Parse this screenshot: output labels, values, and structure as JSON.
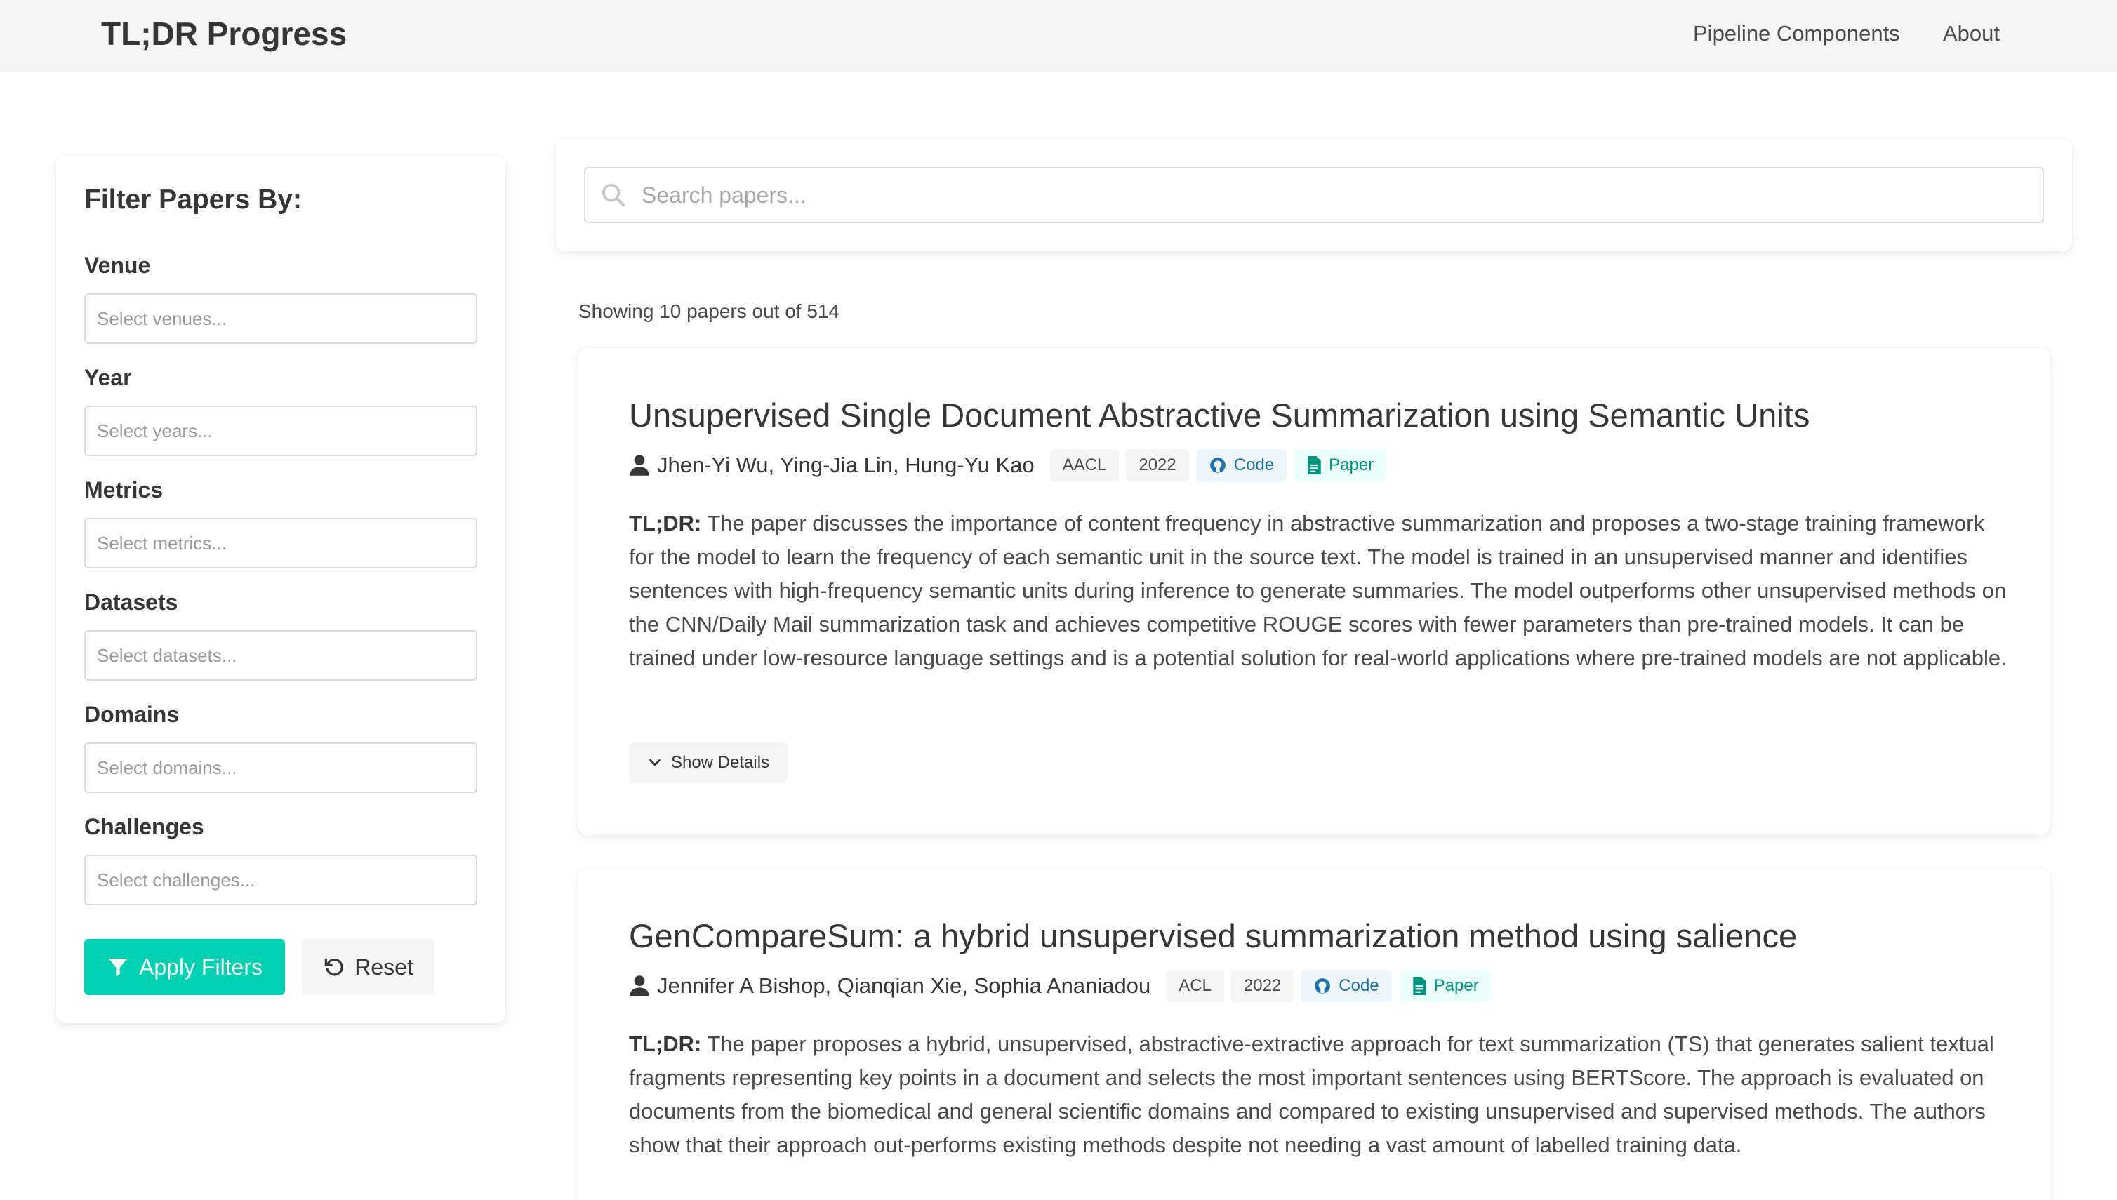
{
  "nav": {
    "brand": "TL;DR Progress",
    "links": [
      "Pipeline Components",
      "About"
    ]
  },
  "sidebar": {
    "title": "Filter Papers By:",
    "filters": [
      {
        "label": "Venue",
        "placeholder": "Select venues..."
      },
      {
        "label": "Year",
        "placeholder": "Select years..."
      },
      {
        "label": "Metrics",
        "placeholder": "Select metrics..."
      },
      {
        "label": "Datasets",
        "placeholder": "Select datasets..."
      },
      {
        "label": "Domains",
        "placeholder": "Select domains..."
      },
      {
        "label": "Challenges",
        "placeholder": "Select challenges..."
      }
    ],
    "apply_label": "Apply Filters",
    "reset_label": "Reset"
  },
  "search": {
    "placeholder": "Search papers...",
    "value": ""
  },
  "results": {
    "count_text": "Showing 10 papers out of 514"
  },
  "papers": [
    {
      "title": "Unsupervised Single Document Abstractive Summarization using Semantic Units",
      "authors": "Jhen-Yi Wu, Ying-Jia Lin, Hung-Yu Kao",
      "venue": "AACL",
      "year": "2022",
      "code_label": "Code",
      "paper_label": "Paper",
      "tldr_label": "TL;DR:",
      "tldr": "The paper discusses the importance of content frequency in abstractive summarization and proposes a two-stage training framework for the model to learn the frequency of each semantic unit in the source text. The model is trained in an unsupervised manner and identifies sentences with high-frequency semantic units during inference to generate summaries. The model outperforms other unsupervised methods on the CNN/Daily Mail summarization task and achieves competitive ROUGE scores with fewer parameters than pre-trained models. It can be trained under low-resource language settings and is a potential solution for real-world applications where pre-trained models are not applicable.",
      "details_label": "Show Details"
    },
    {
      "title": "GenCompareSum: a hybrid unsupervised summarization method using salience",
      "authors": "Jennifer A Bishop, Qianqian Xie, Sophia Ananiadou",
      "venue": "ACL",
      "year": "2022",
      "code_label": "Code",
      "paper_label": "Paper",
      "tldr_label": "TL;DR:",
      "tldr": "The paper proposes a hybrid, unsupervised, abstractive-extractive approach for text summarization (TS) that generates salient textual fragments representing key points in a document and selects the most important sentences using BERTScore. The approach is evaluated on documents from the biomedical and general scientific domains and compared to existing unsupervised and supervised methods. The authors show that their approach out-performs existing methods despite not needing a vast amount of labelled training data."
    }
  ],
  "colors": {
    "primary": "#00d1b2",
    "navbar_bg": "#f5f5f5",
    "code_tag": "#1d72aa",
    "paper_tag": "#00947e"
  }
}
